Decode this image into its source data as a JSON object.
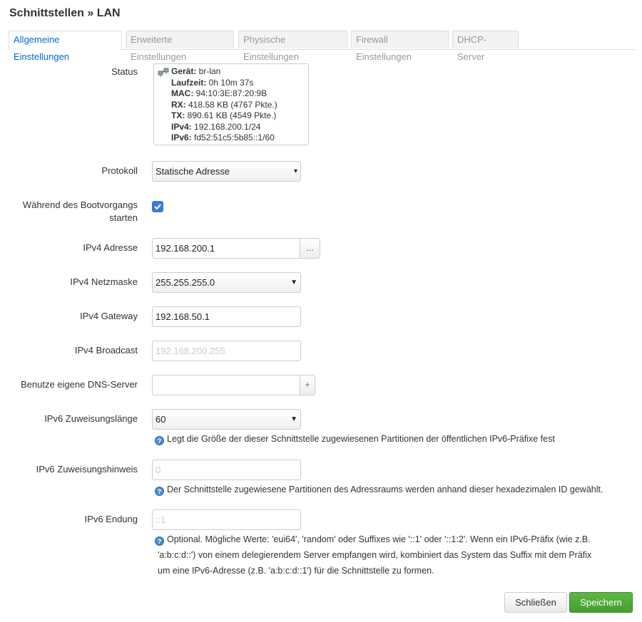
{
  "page": {
    "title": "Schnittstellen » LAN"
  },
  "tabs": [
    {
      "label": "Allgemeine Einstellungen"
    },
    {
      "label": "Erweiterte Einstellungen"
    },
    {
      "label": "Physische Einstellungen"
    },
    {
      "label": "Firewall Einstellungen"
    },
    {
      "label": "DHCP-Server"
    }
  ],
  "status": {
    "label": "Status",
    "lines": [
      {
        "k": "Gerät:",
        "v": " br-lan"
      },
      {
        "k": "Laufzeit:",
        "v": " 0h 10m 37s"
      },
      {
        "k": "MAC:",
        "v": " 94:10:3E:87:20:9B"
      },
      {
        "k": "RX:",
        "v": " 418.58 KB (4767 Pkte.)"
      },
      {
        "k": "TX:",
        "v": " 890.61 KB (4549 Pkte.)"
      },
      {
        "k": "IPv4:",
        "v": " 192.168.200.1/24"
      },
      {
        "k": "IPv6:",
        "v": " fd52:51c5:5b85::1/60"
      }
    ]
  },
  "protocol": {
    "label": "Protokoll",
    "value": "Statische Adresse"
  },
  "boot": {
    "label_1": "Während des Bootvorgangs",
    "label_2": "starten",
    "checked": true
  },
  "ipv4_addr": {
    "label": "IPv4 Adresse",
    "value": "192.168.200.1",
    "addon": "..."
  },
  "ipv4_mask": {
    "label": "IPv4 Netzmaske",
    "value": "255.255.255.0"
  },
  "ipv4_gw": {
    "label": "IPv4 Gateway",
    "value": "192.168.50.1"
  },
  "ipv4_bc": {
    "label": "IPv4 Broadcast",
    "placeholder": "192.168.200.255"
  },
  "dns": {
    "label": "Benutze eigene DNS-Server",
    "value": "",
    "addon": "+"
  },
  "ipv6_len": {
    "label": "IPv6 Zuweisungslänge",
    "value": "60",
    "help": "Legt die Größe der dieser Schnittstelle zugewiesenen Partitionen der öffentlichen IPv6-Präfixe fest"
  },
  "ipv6_hint": {
    "label": "IPv6 Zuweisungshinweis",
    "placeholder": "0",
    "help": "Der Schnittstelle zugewiesene Partitionen des Adressraums werden anhand dieser hexadezimalen ID gewählt."
  },
  "ipv6_suffix": {
    "label": "IPv6 Endung",
    "placeholder": "::1",
    "help_1": "Optional. Mögliche Werte: 'eui64', 'random' oder Suffixes wie '::1' oder '::1:2'. Wenn ein IPv6-Präfix (wie z.B.",
    "help_2": "'a:b:c:d::') von einem delegierendem Server empfangen wird, kombiniert das System das Suffix mit dem Präfix",
    "help_3": "um eine IPv6-Adresse (z.B. 'a:b:c:d::1') für die Schnittstelle zu formen."
  },
  "buttons": {
    "close": "Schließen",
    "save": "Speichern"
  },
  "colors": {
    "accent": "#0069d6",
    "save": "#4fa83a",
    "checkbox": "#3a7bd5"
  }
}
